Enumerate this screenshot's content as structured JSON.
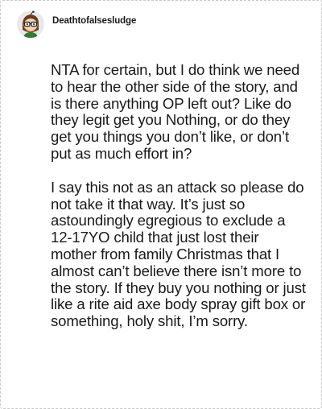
{
  "post": {
    "username": "Deathtofalsesludge",
    "avatar_icon": "snoo-avatar-icon",
    "paragraphs": [
      "NTA for certain, but I do think we need to hear the other side of the story, and is there anything OP left out? Like do they legit get you Nothing, or do they get you things you don’t like, or don’t put as much effort in?",
      "I say this not as an attack so please do not take it that way. It’s just so astoundingly egregious to exclude a 12-17YO child that just lost their mother from family Christmas that I almost can’t believe there isn’t more to the story. If they buy you nothing or just like a rite aid axe body spray gift box or something, holy shit, I’m sorry."
    ]
  }
}
